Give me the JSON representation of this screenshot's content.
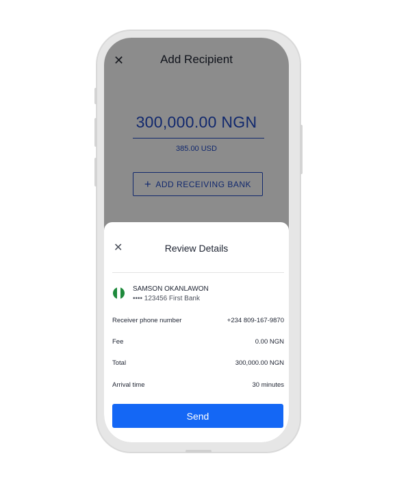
{
  "add_recipient": {
    "title": "Add Recipient",
    "close_glyph": "✕",
    "amount": "300,000.00 NGN",
    "converted_amount": "385.00 USD",
    "add_bank_plus": "+",
    "add_bank_label": "ADD RECEIVING BANK"
  },
  "review_sheet": {
    "title": "Review Details",
    "close_glyph": "✕",
    "recipient": {
      "name": "SAMSON OKANLAWON",
      "account": "•••• 123456 First Bank",
      "flag_icon": "nigeria-flag-icon"
    },
    "rows": [
      {
        "label": "Receiver phone number",
        "value": "+234 809-167-9870"
      },
      {
        "label": "Fee",
        "value": "0.00 NGN"
      },
      {
        "label": "Total",
        "value": "300,000.00 NGN"
      },
      {
        "label": "Arrival time",
        "value": "30 minutes"
      }
    ],
    "send_label": "Send"
  },
  "colors": {
    "brand_blue": "#1f49c7",
    "send_blue": "#1467f5",
    "flag_green": "#1e8a3c"
  }
}
